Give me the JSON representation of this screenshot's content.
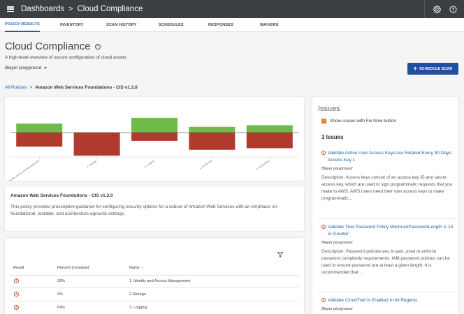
{
  "header": {
    "breadcrumb_root": "Dashboards",
    "breadcrumb_separator": ">",
    "breadcrumb_current": "Cloud Compliance",
    "icons": [
      "menu-icon",
      "gear-icon",
      "help-icon"
    ]
  },
  "tabs": [
    {
      "label": "POLICY RESULTS",
      "active": true
    },
    {
      "label": "INVENTORY",
      "active": false
    },
    {
      "label": "SCAN HISTORY",
      "active": false
    },
    {
      "label": "SCHEDULES",
      "active": false
    },
    {
      "label": "RESPONSES",
      "active": false
    },
    {
      "label": "WAIVERS",
      "active": false
    }
  ],
  "page": {
    "title": "Cloud Compliance",
    "subtitle": "A high-level overview of secure configuration of cloud assets",
    "environment": "Blayer playground",
    "schedule_button": "SCHEDULE SCAN"
  },
  "policy_breadcrumb": {
    "root": "All Policies",
    "separator": ">",
    "current": "Amazon Web Services Foundations - CIS v1.3.0"
  },
  "chart_data": {
    "type": "bar",
    "categories": [
      "1. Identity and Access Management",
      "2. Storage",
      "3. Logging",
      "4. Monitoring",
      "5. Networking"
    ],
    "series": [
      {
        "values": [
          39,
          0,
          64,
          25,
          32
        ],
        "color": "#6dbb4b"
      },
      {
        "values": [
          -61,
          -100,
          -36,
          -75,
          -68
        ],
        "color": "#b03a2e"
      }
    ],
    "ylim": [
      -100,
      100
    ],
    "colors": {
      "pass": "#6dbb4b",
      "fail": "#b03a2e"
    }
  },
  "description": {
    "title": "Amazon Web Services Foundations - CIS v1.3.0",
    "body": "This policy provides prescriptive guidance for configuring security options for a subset of Amazon Web Services with an emphasis on foundational, testable, and architecture agnostic settings."
  },
  "table": {
    "columns": {
      "result": "Result",
      "percent": "Percent Compliant",
      "name": "Name",
      "sort_indicator": "↑"
    },
    "rows": [
      {
        "status": "!",
        "percent": "39%",
        "name": "1. Identity and Access Management"
      },
      {
        "status": "!",
        "percent": "0%",
        "name": "2 Storage"
      },
      {
        "status": "!",
        "percent": "64%",
        "name": "3. Logging"
      }
    ]
  },
  "issues": {
    "title": "Issues",
    "fix_now_label": "Show issues with Fix Now button",
    "fix_now_checked": true,
    "count_label": "3 Issues",
    "items": [
      {
        "title": "Validate Active User Access Keys Are Rotated Every 90 Days: Access Key 1",
        "environment": "Blayer playground",
        "description": "Description: Access keys consist of an access key ID and secret access key, which are used to sign programmatic requests that you make to AWS. AWS users need their own access keys to make programmatic..."
      },
      {
        "title": "Validate That Password Policy MinimumPasswordLength is 14 or Greater",
        "environment": "Blayer playground",
        "description": "Description: Password policies are, in part, used to enforce password complexity requirements. IAM password policies can be used to ensure password are at least a given length. It is recommended that ..."
      },
      {
        "title": "Validate CloudTrail Is Enabled In All Regions",
        "environment": "Blayer playground",
        "description": ""
      }
    ]
  }
}
